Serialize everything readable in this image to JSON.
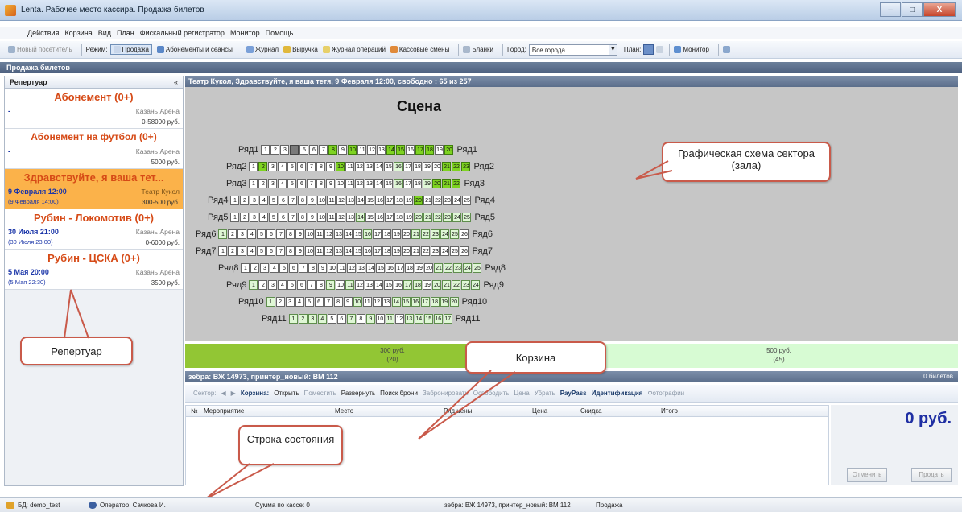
{
  "window": {
    "title": "Lenta. Рабочее место кассира. Продажа билетов",
    "min": "–",
    "max": "□",
    "close": "X"
  },
  "menu": [
    "Действия",
    "Корзина",
    "Вид",
    "План",
    "Фискальный регистратор",
    "Монитор",
    "Помощь"
  ],
  "toolbar": {
    "new_visitor": "Новый посетитель",
    "mode_label": "Режим:",
    "mode_value": "Продажа",
    "subscriptions": "Абонементы и сеансы",
    "journal": "Журнал",
    "revenue": "Выручка",
    "ops_journal": "Журнал операций",
    "shifts": "Кассовые смены",
    "forms": "Бланки",
    "city_label": "Город:",
    "city_value": "Все города",
    "plan": "План:",
    "monitor": "Монитор"
  },
  "section_title": "Продажа билетов",
  "repertoire": {
    "header": "Репертуар",
    "collapse": "«",
    "cards": [
      {
        "name": "Абонемент (0+)",
        "date": "-",
        "place": "Казань Арена",
        "sub": "",
        "price": "0-58000 руб."
      },
      {
        "name": "Абонемент на футбол (0+)",
        "date": "-",
        "place": "Казань Арена",
        "sub": "",
        "price": "5000 руб."
      },
      {
        "name": "Здравствуйте, я ваша тет...",
        "date": "9 Февраля 12:00",
        "place": "Театр Кукол",
        "sub": "(9 Февраля 14:00)",
        "price": "300-500 руб."
      },
      {
        "name": "Рубин - Локомотив (0+)",
        "date": "30 Июля 21:00",
        "place": "Казань Арена",
        "sub": "(30 Июля 23:00)",
        "price": "0-6000 руб."
      },
      {
        "name": "Рубин - ЦСКА (0+)",
        "date": "5 Мая 20:00",
        "place": "Казань Арена",
        "sub": "(5 Мая 22:30)",
        "price": "3500 руб."
      }
    ]
  },
  "hall": {
    "header": "Театр Кукол, Здравствуйте, я ваша тетя, 9 Февраля 12:00, свободно : 65 из 257",
    "stage": "Сцена"
  },
  "rows": [
    {
      "label": "Ряд1",
      "seats": "wwwxwwwgwgwwwggwggwg",
      "start": 1
    },
    {
      "label": "Ряд2",
      "seats": "wgwwwwwwwgwwwwwlwwwwggg",
      "start": 1
    },
    {
      "label": "Ряд3",
      "seats": "wwwwwwwwwwwwwwwlwwlggg",
      "start": 1
    },
    {
      "label": "Ряд4",
      "seats": "wwwwwwwwwwwwwwwwwwwgwwwww",
      "start": 1
    },
    {
      "label": "Ряд5",
      "seats": "wwwwwwwwwwwwwlwwwwwllllll",
      "start": 1
    },
    {
      "label": "Ряд6",
      "seats": "lwwwwwwwwwwwwwwlwwwwlllllw",
      "start": 1
    },
    {
      "label": "Ряд7",
      "seats": "wwwwwwwwwwwwwwwwwwwwwwwwww",
      "start": 1
    },
    {
      "label": "Ряд8",
      "seats": "wwwwwwwwwwwwwwwwwwwwlllll",
      "start": 1
    },
    {
      "label": "Ряд9",
      "seats": "lwwwwwwwlwlwwwwwllwlllll",
      "start": 1
    },
    {
      "label": "Ряд10",
      "seats": "lwwwwwwwwlwwwlllllll",
      "start": 1
    },
    {
      "label": "Ряд11",
      "seats": "llllwwlwlwlwlllll",
      "start": 1
    }
  ],
  "price_zones": [
    {
      "price": "300 руб.",
      "count": "(20)"
    },
    {
      "price": "500 руб.",
      "count": "(45)"
    }
  ],
  "cart": {
    "header": "зебра: ВЖ 14973, принтер_новый: ВМ 112",
    "count": "0 билетов",
    "sector": "Сектор:",
    "basket": "Корзина:",
    "open": "Открыть",
    "place": "Поместить",
    "expand": "Развернуть",
    "search": "Поиск брони",
    "reserve": "Забронировать",
    "release": "Освободить",
    "price": "Цена",
    "remove": "Убрать",
    "paypass": "PayPass",
    "ident": "Идентификация",
    "photos": "Фотографии",
    "cols": [
      "№",
      "Мероприятие",
      "Место",
      "Ряд цены",
      "Цена",
      "Скидка",
      "Итого"
    ],
    "total": "0 руб.",
    "cancel": "Отменить",
    "sell": "Продать"
  },
  "status": {
    "db": "БД: demo_test",
    "operator": "Оператор: Сачкова И.",
    "cash": "Сумма по кассе: 0",
    "printer": "зебра: ВЖ 14973, принтер_новый: ВМ 112",
    "mode": "Продажа"
  },
  "callouts": {
    "hall": "Графическая схема сектора (зала)",
    "repertoire": "Репертуар",
    "cart": "Корзина",
    "status": "Строка состояния"
  }
}
